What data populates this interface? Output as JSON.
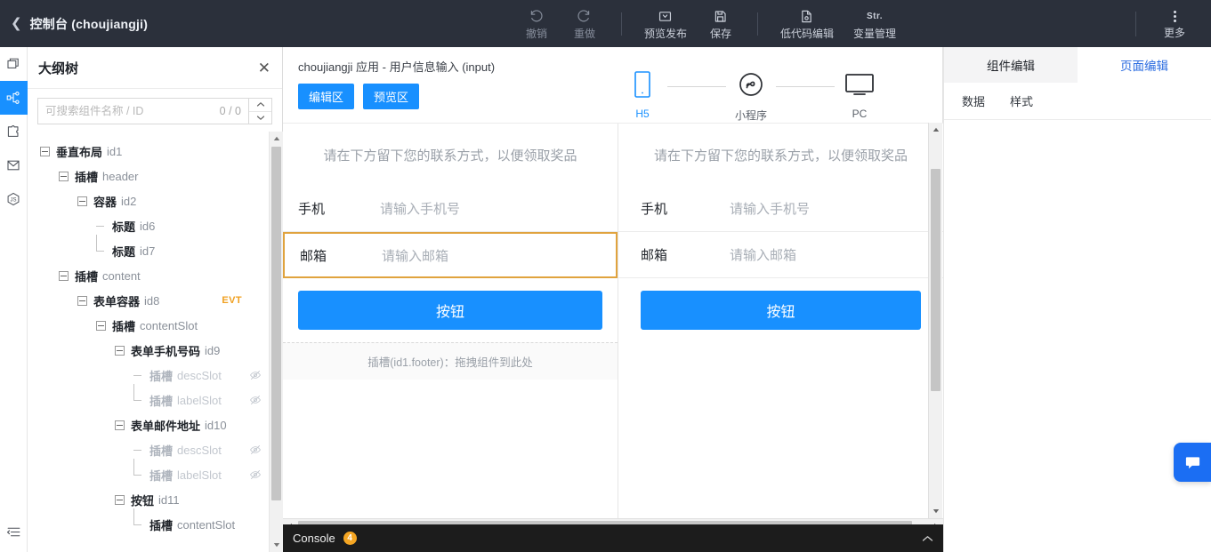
{
  "topbar": {
    "back_icon": "chevron-left-icon",
    "title": "控制台 (choujiangji)",
    "tools": [
      {
        "id": "undo",
        "label": "撤销",
        "icon": "undo-icon",
        "dim": true
      },
      {
        "id": "redo",
        "label": "重做",
        "icon": "redo-icon",
        "dim": true
      },
      {
        "id": "preview",
        "label": "预览发布",
        "icon": "publish-icon",
        "dim": false
      },
      {
        "id": "save",
        "label": "保存",
        "icon": "save-icon",
        "dim": false
      },
      {
        "id": "lowcode",
        "label": "低代码编辑",
        "icon": "code-file-icon",
        "dim": false
      },
      {
        "id": "variables",
        "label": "变量管理",
        "icon": "str-icon",
        "dim": false,
        "glyph": "Str."
      }
    ],
    "more_label": "更多",
    "more_icon": "more-vertical-icon"
  },
  "rail": {
    "items": [
      {
        "id": "pages",
        "icon": "pages-icon",
        "active": false
      },
      {
        "id": "outline",
        "icon": "node-tree-icon",
        "active": true
      },
      {
        "id": "plugin",
        "icon": "puzzle-icon",
        "active": false
      },
      {
        "id": "media",
        "icon": "inbox-icon",
        "active": false
      },
      {
        "id": "js",
        "icon": "js-icon",
        "active": false
      }
    ],
    "collapse_icon": "collapse-panel-icon"
  },
  "tree": {
    "title": "大纲树",
    "close_icon": "close-icon",
    "search_placeholder": "可搜索组件名称 / ID",
    "search_value": "",
    "match_count": "0 / 0",
    "up_icon": "chevron-up-icon",
    "down_icon": "chevron-down-icon",
    "nodes": [
      {
        "depth": 0,
        "name": "垂直布局",
        "id": "id1",
        "toggle": true,
        "muted": false,
        "badge": "",
        "eye": false,
        "last": false
      },
      {
        "depth": 1,
        "name": "插槽",
        "id": "header",
        "toggle": true,
        "muted": false,
        "badge": "",
        "eye": false,
        "last": false
      },
      {
        "depth": 2,
        "name": "容器",
        "id": "id2",
        "toggle": true,
        "muted": false,
        "badge": "",
        "eye": false,
        "last": false
      },
      {
        "depth": 3,
        "name": "标题",
        "id": "id6",
        "toggle": false,
        "muted": false,
        "badge": "",
        "eye": false,
        "last": false
      },
      {
        "depth": 3,
        "name": "标题",
        "id": "id7",
        "toggle": false,
        "muted": false,
        "badge": "",
        "eye": false,
        "last": true
      },
      {
        "depth": 1,
        "name": "插槽",
        "id": "content",
        "toggle": true,
        "muted": false,
        "badge": "",
        "eye": false,
        "last": false
      },
      {
        "depth": 2,
        "name": "表单容器",
        "id": "id8",
        "toggle": true,
        "muted": false,
        "badge": "EVT",
        "eye": false,
        "last": false
      },
      {
        "depth": 3,
        "name": "插槽",
        "id": "contentSlot",
        "toggle": true,
        "muted": false,
        "badge": "",
        "eye": false,
        "last": false
      },
      {
        "depth": 4,
        "name": "表单手机号码",
        "id": "id9",
        "toggle": true,
        "muted": false,
        "badge": "",
        "eye": false,
        "last": false
      },
      {
        "depth": 5,
        "name": "插槽",
        "id": "descSlot",
        "toggle": false,
        "muted": true,
        "badge": "",
        "eye": true,
        "last": false
      },
      {
        "depth": 5,
        "name": "插槽",
        "id": "labelSlot",
        "toggle": false,
        "muted": true,
        "badge": "",
        "eye": true,
        "last": true
      },
      {
        "depth": 4,
        "name": "表单邮件地址",
        "id": "id10",
        "toggle": true,
        "muted": false,
        "badge": "",
        "eye": false,
        "last": false
      },
      {
        "depth": 5,
        "name": "插槽",
        "id": "descSlot",
        "toggle": false,
        "muted": true,
        "badge": "",
        "eye": true,
        "last": false
      },
      {
        "depth": 5,
        "name": "插槽",
        "id": "labelSlot",
        "toggle": false,
        "muted": true,
        "badge": "",
        "eye": true,
        "last": true
      },
      {
        "depth": 4,
        "name": "按钮",
        "id": "id11",
        "toggle": true,
        "muted": false,
        "badge": "",
        "eye": false,
        "last": false
      },
      {
        "depth": 5,
        "name": "插槽",
        "id": "contentSlot",
        "toggle": false,
        "muted": false,
        "badge": "",
        "eye": false,
        "last": true
      }
    ]
  },
  "canvas": {
    "title": "choujiangji 应用 - 用户信息输入 (input)",
    "buttons": [
      {
        "id": "edit-area",
        "label": "编辑区"
      },
      {
        "id": "preview-area",
        "label": "预览区"
      }
    ],
    "devices": [
      {
        "id": "h5",
        "label": "H5",
        "icon": "mobile-icon",
        "active": true
      },
      {
        "id": "mini",
        "label": "小程序",
        "icon": "miniprogram-icon",
        "active": false
      },
      {
        "id": "pc",
        "label": "PC",
        "icon": "desktop-icon",
        "active": false
      }
    ],
    "form": {
      "hint": "请在下方留下您的联系方式，以便领取奖品",
      "rows": [
        {
          "label": "手机",
          "placeholder": "请输入手机号",
          "selected": false
        },
        {
          "label": "邮箱",
          "placeholder": "请输入邮箱",
          "selected": true
        }
      ],
      "submit_label": "按钮",
      "footer_slot": "插槽(id1.footer)：拖拽组件到此处"
    },
    "preview_form": {
      "hint": "请在下方留下您的联系方式，以便领取奖品",
      "rows": [
        {
          "label": "手机",
          "placeholder": "请输入手机号"
        },
        {
          "label": "邮箱",
          "placeholder": "请输入邮箱"
        }
      ],
      "submit_label": "按钮"
    },
    "selection_color": "#e0a33e",
    "accent_color": "#1890ff"
  },
  "console": {
    "label": "Console",
    "badge": "4",
    "chevron_icon": "chevron-up-icon",
    "badge_color": "#f5a623"
  },
  "right_panel": {
    "tabs": [
      {
        "id": "component-edit",
        "label": "组件编辑",
        "active": true
      },
      {
        "id": "page-edit",
        "label": "页面编辑",
        "active": false
      }
    ],
    "subtabs": [
      {
        "id": "data",
        "label": "数据"
      },
      {
        "id": "style",
        "label": "样式"
      }
    ]
  },
  "chat": {
    "icon": "chat-bubble-icon",
    "color": "#1b6ef3"
  }
}
